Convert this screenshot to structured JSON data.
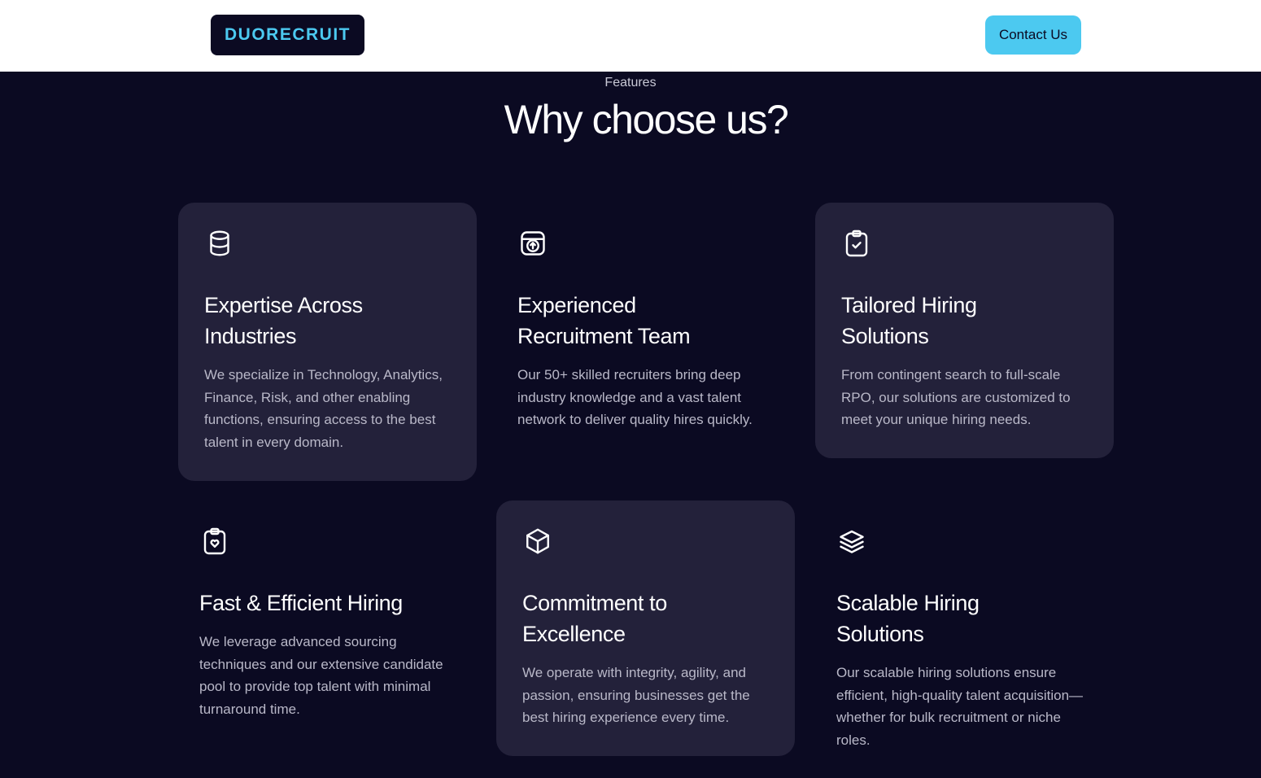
{
  "header": {
    "logo_text": "DUORECRUIT",
    "contact_label": "Contact Us"
  },
  "section": {
    "eyebrow": "Features",
    "title": "Why choose us?"
  },
  "features": [
    {
      "icon": "database-icon",
      "title": "Expertise Across Industries",
      "description": "We specialize in Technology, Analytics, Finance, Risk, and other enabling functions, ensuring access to the best talent in every domain.",
      "highlighted": true
    },
    {
      "icon": "upload-box-icon",
      "title": "Experienced Recruitment Team",
      "description": "Our 50+ skilled recruiters bring deep industry knowledge and a vast talent network to deliver quality hires quickly.",
      "highlighted": false
    },
    {
      "icon": "clipboard-check-icon",
      "title": "Tailored Hiring Solutions",
      "description": "From contingent search to full-scale RPO, our solutions are customized to meet your unique hiring needs.",
      "highlighted": true
    },
    {
      "icon": "clipboard-heart-icon",
      "title": "Fast & Efficient Hiring",
      "description": "We leverage advanced sourcing techniques and our extensive candidate pool to provide top talent with minimal turnaround time.",
      "highlighted": false
    },
    {
      "icon": "cube-icon",
      "title": "Commitment to Excellence",
      "description": "We operate with integrity, agility, and passion, ensuring businesses get the best hiring experience every time.",
      "highlighted": true
    },
    {
      "icon": "layers-icon",
      "title": "Scalable Hiring Solutions",
      "description": "Our scalable hiring solutions ensure efficient, high-quality talent acquisition—whether for bulk recruitment or niche roles.",
      "highlighted": false
    }
  ],
  "colors": {
    "background": "#0b0a22",
    "card": "#23213a",
    "accent": "#4cc9f0",
    "header": "#ffffff"
  }
}
